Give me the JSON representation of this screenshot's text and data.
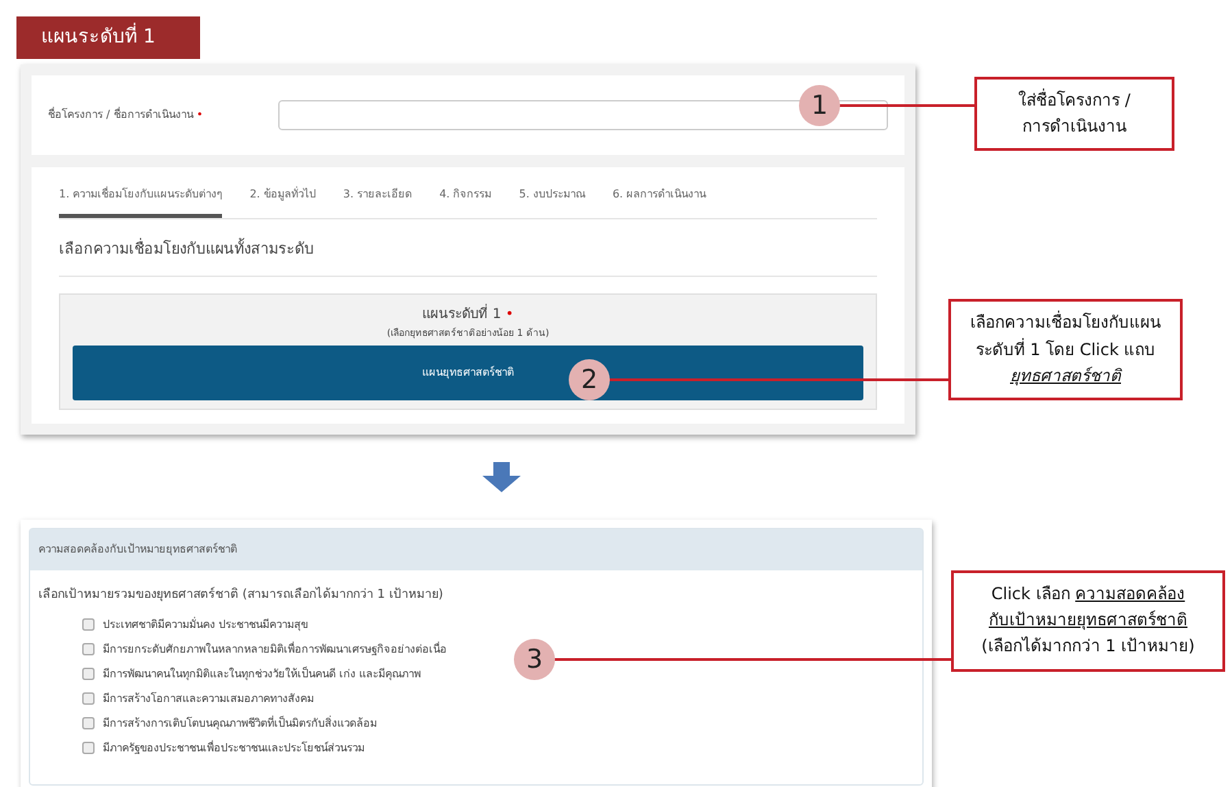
{
  "heading": "แผนระดับที่ 1",
  "project_field": {
    "label": "ชื่อโครงการ / ชื่อการดำเนินงาน",
    "required_mark": "•"
  },
  "tabs": [
    {
      "label": "1. ความเชื่อมโยงกับแผนระดับต่างๆ",
      "selected": true
    },
    {
      "label": "2. ข้อมูลทั่วไป",
      "selected": false
    },
    {
      "label": "3. รายละเอียด",
      "selected": false
    },
    {
      "label": "4. กิจกรรม",
      "selected": false
    },
    {
      "label": "5. งบประมาณ",
      "selected": false
    },
    {
      "label": "6. ผลการดำเนินงาน",
      "selected": false
    }
  ],
  "section_title": "เลือกความเชื่อมโยงกับแผนทั้งสามระดับ",
  "plan_box": {
    "title": "แผนระดับที่ 1",
    "required_mark": "•",
    "hint": "(เลือกยุทธศาสตร์ชาติอย่างน้อย 1 ด้าน)",
    "button": "แผนยุทธศาสตร์ชาติ"
  },
  "goals_panel": {
    "header": "ความสอดคล้องกับเป้าหมายยุทธศาสตร์ชาติ",
    "prompt": "เลือกเป้าหมายรวมของยุทธศาสตร์ชาติ (สามารถเลือกได้มากกว่า 1 เป้าหมาย)",
    "options": [
      {
        "label": "ประเทศชาติมีความมั่นคง ประชาชนมีความสุข",
        "checked": false
      },
      {
        "label": "มีการยกระดับศักยภาพในหลากหลายมิติเพื่อการพัฒนาเศรษฐกิจอย่างต่อเนื่อ",
        "checked": false
      },
      {
        "label": "มีการพัฒนาคนในทุกมิติและในทุกช่วงวัยให้เป็นคนดี เก่ง และมีคุณภาพ",
        "checked": false
      },
      {
        "label": "มีการสร้างโอกาสและความเสมอภาคทางสังคม",
        "checked": false
      },
      {
        "label": "มีการสร้างการเติบโตบนคุณภาพชีวิตที่เป็นมิตรกับสิ่งแวดล้อม",
        "checked": false
      },
      {
        "label": "มีภาครัฐของประชาชนเพื่อประชาชนและประโยชน์ส่วนรวม",
        "checked": false
      }
    ]
  },
  "markers": [
    "1",
    "2",
    "3"
  ],
  "callouts": [
    {
      "lines": [
        [
          {
            "text": "ใส่ชื่อโครงการ /",
            "kind": "plain"
          }
        ],
        [
          {
            "text": "การดำเนินงาน",
            "kind": "plain"
          }
        ]
      ]
    },
    {
      "lines": [
        [
          {
            "text": "เลือกความเชื่อมโยงกับแผน",
            "kind": "plain"
          }
        ],
        [
          {
            "text": "ระดับที่ 1 โดย Click แถบ",
            "kind": "plain"
          }
        ],
        [
          {
            "text": "ยุทธศาสตร์ชาติ",
            "kind": "underlined_italic"
          }
        ]
      ]
    },
    {
      "lines": [
        [
          {
            "text": "Click เลือก ",
            "kind": "plain"
          },
          {
            "text": "ความสอดคล้อง",
            "kind": "underlined"
          }
        ],
        [
          {
            "text": "กับเป้าหมายยุทธศาสตร์ชาติ",
            "kind": "underlined"
          }
        ],
        [
          {
            "text": "(เลือกได้มากกว่า 1 เป้าหมาย)",
            "kind": "plain"
          }
        ]
      ]
    }
  ]
}
